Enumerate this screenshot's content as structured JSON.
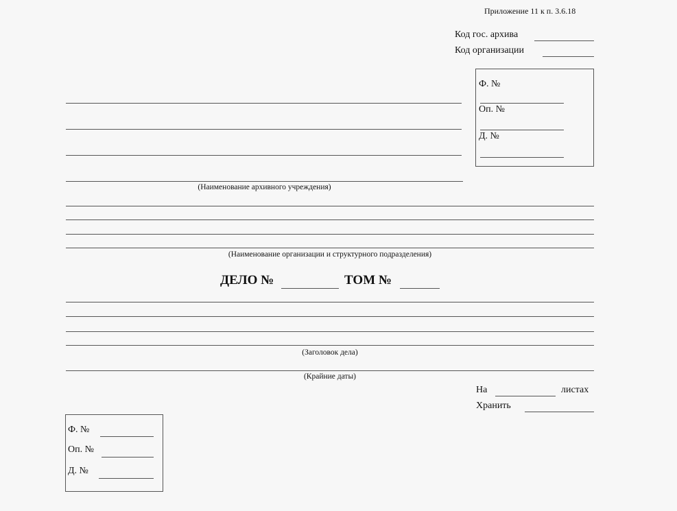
{
  "appendix": "Приложение 11 к п. 3.6.18",
  "codes": {
    "archive_label": "Код гос. архива",
    "org_label": "Код организации"
  },
  "top_box": {
    "fond": "Ф. №",
    "opis": "Оп. №",
    "delo": "Д. №"
  },
  "captions": {
    "archive_name": "(Наименование архивного учреждения)",
    "org_name": "(Наименование организации и структурного подразделения)",
    "case_title": "(Заголовок дела)",
    "dates": "(Крайние даты)"
  },
  "title": {
    "delo": "ДЕЛО №",
    "tom": "ТОМ №"
  },
  "sheets": {
    "na": "На",
    "listakh": "листах",
    "khranit": "Хранить"
  },
  "bottom_box": {
    "fond": "Ф. №",
    "opis": "Оп. №",
    "delo": "Д. №"
  }
}
